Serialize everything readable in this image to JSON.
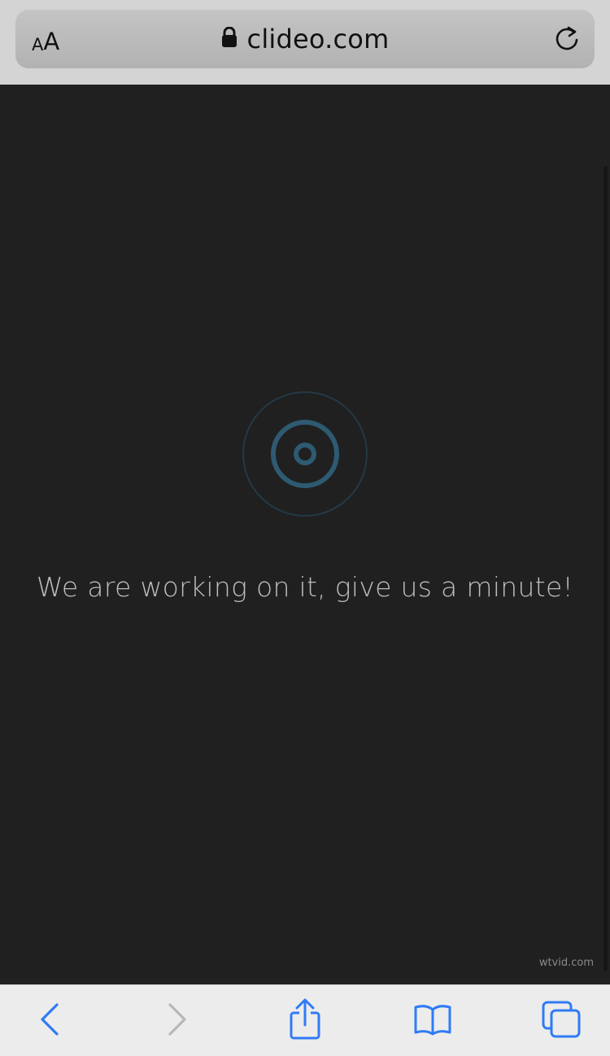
{
  "browser": {
    "text_size_label_small": "A",
    "text_size_label_large": "A",
    "url": "clideo.com",
    "lock_icon": "lock-icon",
    "reload_icon": "reload-icon"
  },
  "page": {
    "loader_icon": "target-spinner-icon",
    "status_message": "We are working on it, give us a minute!",
    "watermark": "wtvid.com"
  },
  "toolbar": {
    "items": [
      {
        "name": "back",
        "icon": "chevron-left-icon",
        "enabled": true
      },
      {
        "name": "forward",
        "icon": "chevron-right-icon",
        "enabled": false
      },
      {
        "name": "share",
        "icon": "share-icon",
        "enabled": true
      },
      {
        "name": "bookmarks",
        "icon": "book-icon",
        "enabled": true
      },
      {
        "name": "tabs",
        "icon": "tabs-icon",
        "enabled": true
      }
    ]
  },
  "colors": {
    "accent": "#2f7bf6",
    "disabled": "#b8b8b8",
    "background": "#202020",
    "spinner": "#2e5a72",
    "text": "#bdbdbd"
  }
}
